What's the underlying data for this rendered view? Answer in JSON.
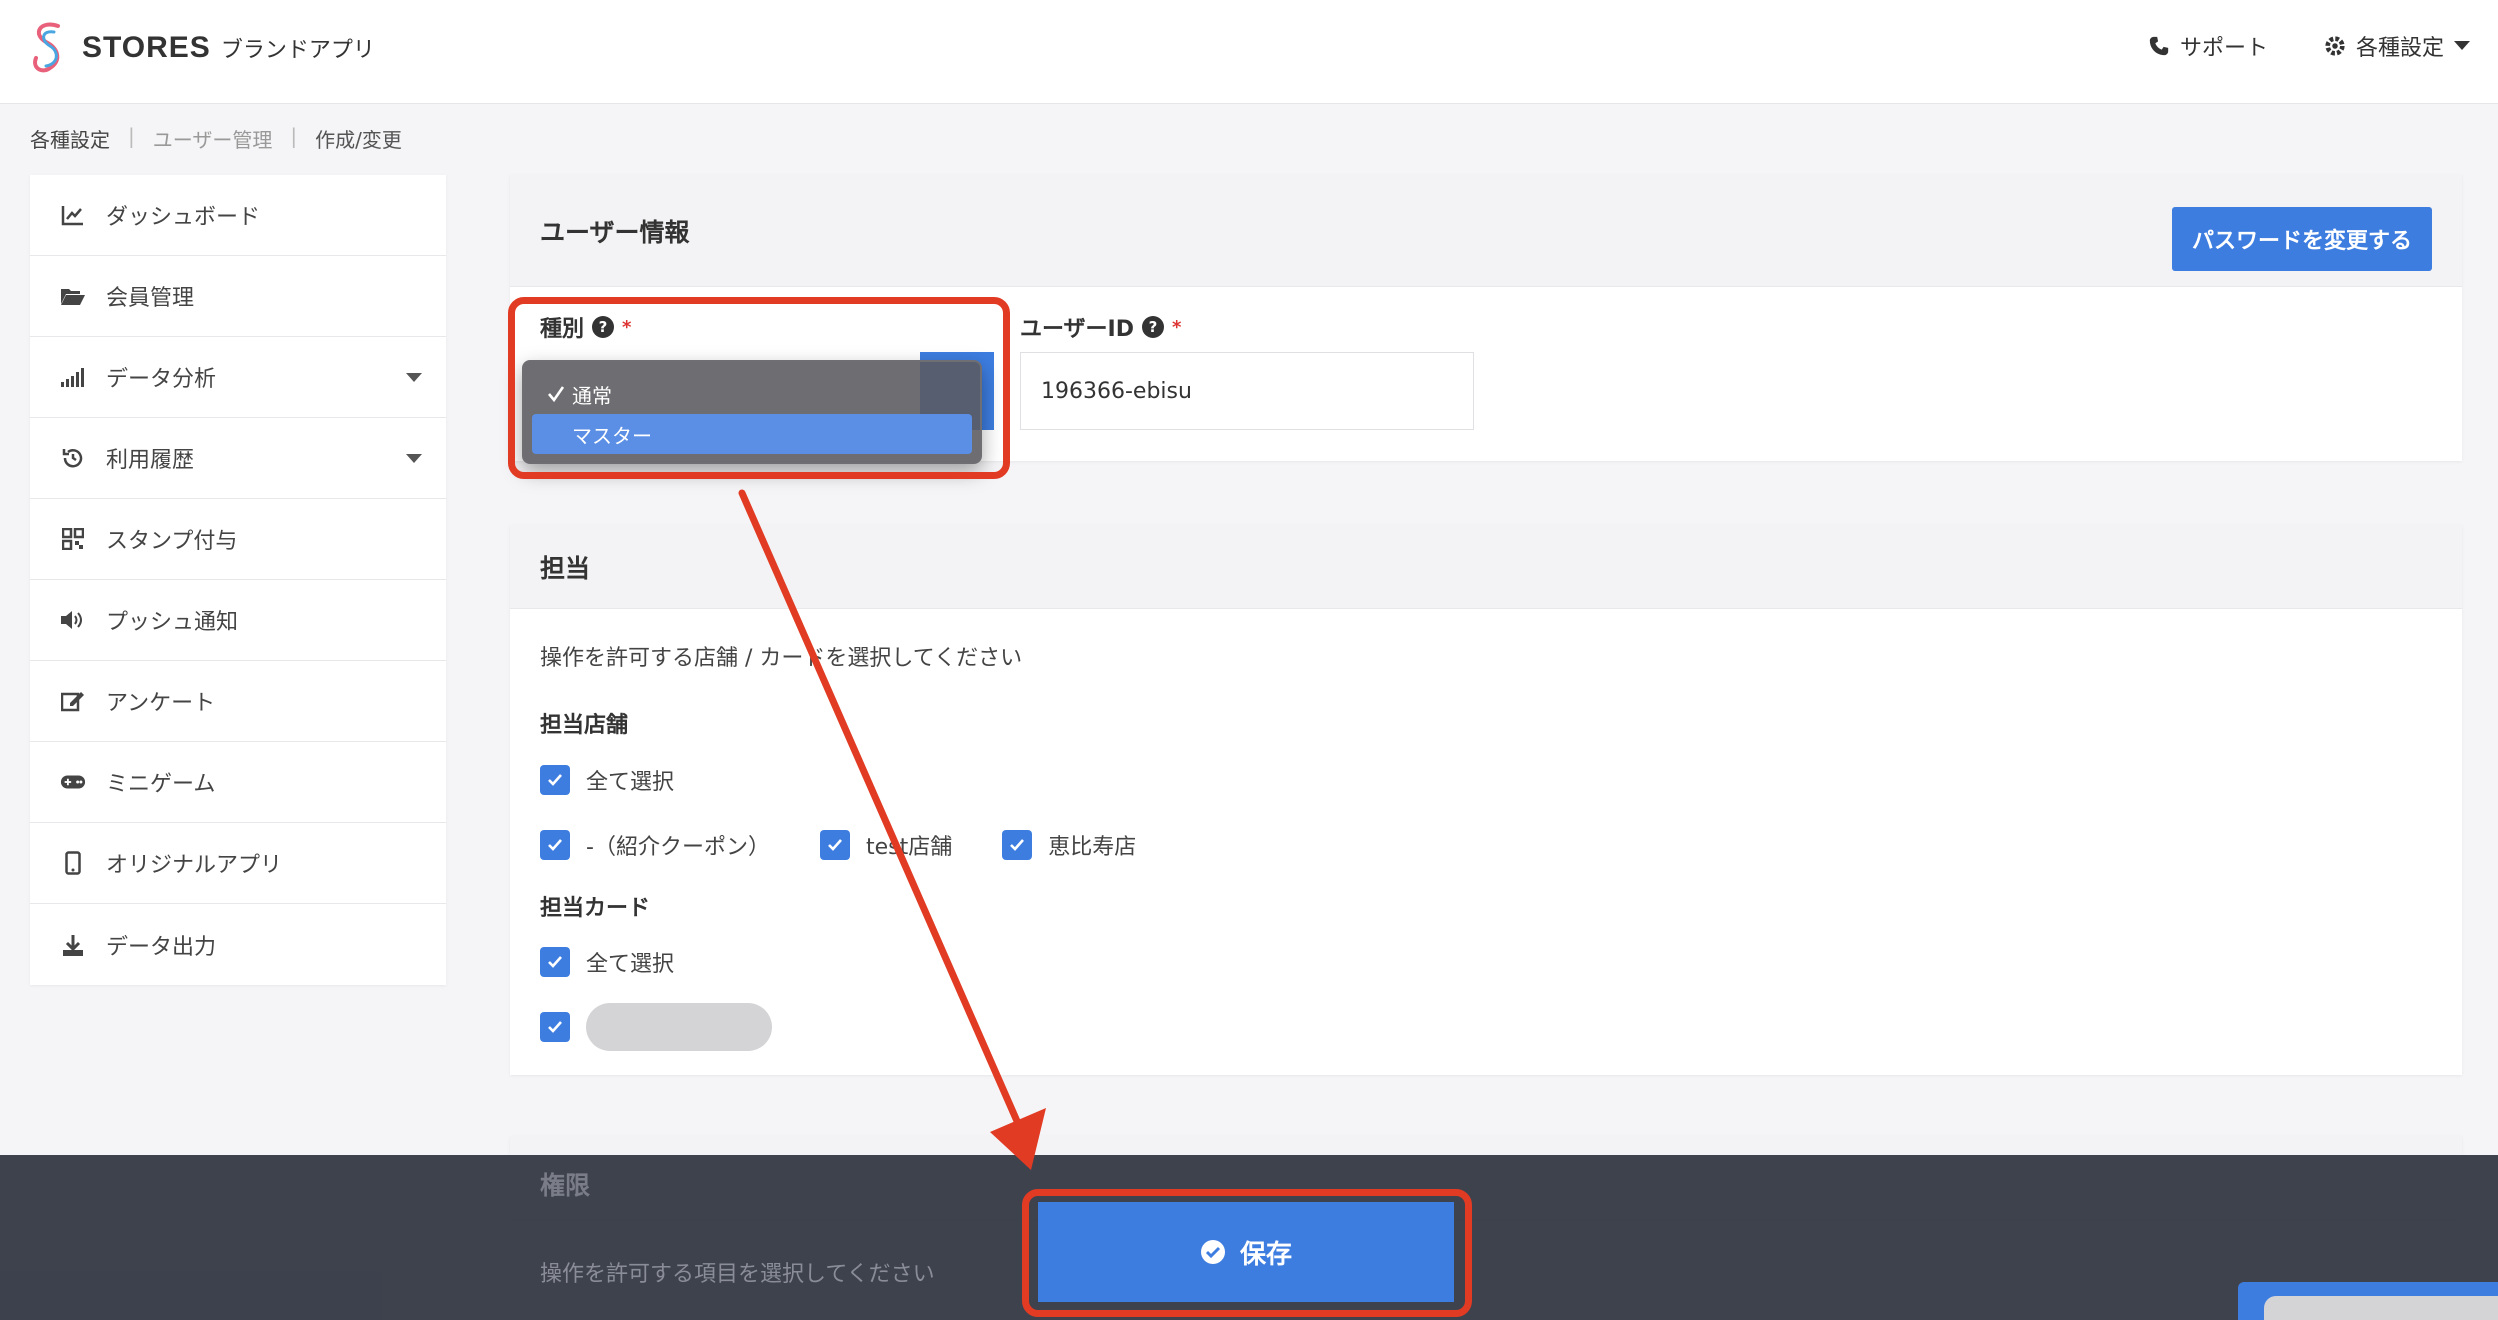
{
  "header": {
    "brand": "STORES",
    "brand_sub": "ブランドアプリ",
    "support_label": "サポート",
    "settings_label": "各種設定"
  },
  "breadcrumb": [
    "各種設定",
    "ユーザー管理",
    "作成/変更"
  ],
  "sidebar": {
    "items": [
      {
        "label": "ダッシュボード",
        "icon": "chart-line-icon"
      },
      {
        "label": "会員管理",
        "icon": "folder-open-icon"
      },
      {
        "label": "データ分析",
        "icon": "signal-bars-icon",
        "has_caret": true
      },
      {
        "label": "利用履歴",
        "icon": "history-icon",
        "has_caret": true
      },
      {
        "label": "スタンプ付与",
        "icon": "qrcode-icon"
      },
      {
        "label": "プッシュ通知",
        "icon": "volume-icon"
      },
      {
        "label": "アンケート",
        "icon": "edit-icon"
      },
      {
        "label": "ミニゲーム",
        "icon": "gamepad-icon"
      },
      {
        "label": "オリジナルアプリ",
        "icon": "mobile-icon"
      },
      {
        "label": "データ出力",
        "icon": "download-icon"
      }
    ]
  },
  "user_info": {
    "title": "ユーザー情報",
    "change_password_label": "パスワードを変更する",
    "type_label": "種別",
    "type_required": "*",
    "type_options": [
      "通常",
      "マスター"
    ],
    "type_checked": "通常",
    "type_highlighted": "マスター",
    "userid_label": "ユーザーID",
    "userid_required": "*",
    "userid_value": "196366-ebisu"
  },
  "assignment": {
    "title": "担当",
    "description": "操作を許可する店舗 / カードを選択してください",
    "stores_label": "担当店舗",
    "select_all": "全て選択",
    "stores": [
      "-（紹介クーポン）",
      "test店舗",
      "恵比寿店"
    ],
    "cards_label": "担当カード",
    "cards_select_all": "全て選択"
  },
  "permissions": {
    "title": "権限",
    "description": "操作を許可する項目を選択してください"
  },
  "footer": {
    "save_label": "保存"
  },
  "colors": {
    "primary": "#3d7de0",
    "annotation_red": "#e23b24",
    "footer_bg": "#323642"
  }
}
